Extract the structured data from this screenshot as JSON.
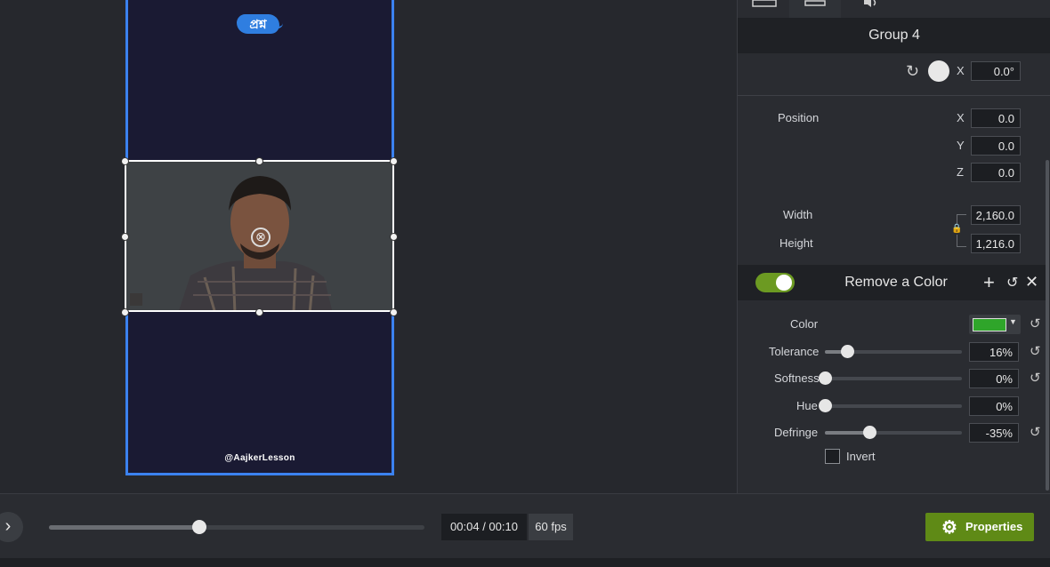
{
  "canvas": {
    "badge_text": "প্রশ্ন",
    "watermark": "@AajkerLesson"
  },
  "panel": {
    "group_title": "Group 4",
    "rotation": {
      "axis_label": "X",
      "value": "0.0°"
    },
    "position": {
      "label": "Position",
      "x_label": "X",
      "x_value": "0.0",
      "y_label": "Y",
      "y_value": "0.0",
      "z_label": "Z",
      "z_value": "0.0"
    },
    "size": {
      "width_label": "Width",
      "width_value": "2,160.0",
      "height_label": "Height",
      "height_value": "1,216.0"
    },
    "remove_color": {
      "title": "Remove a Color",
      "enabled": true,
      "color_label": "Color",
      "color_swatch": "#2fa52a",
      "tolerance_label": "Tolerance",
      "tolerance_value": "16%",
      "tolerance": 0.16,
      "softness_label": "Softness",
      "softness_value": "0%",
      "softness": 0,
      "hue_label": "Hue",
      "hue_value": "0%",
      "hue": 0,
      "defringe_label": "Defringe",
      "defringe_value": "-35%",
      "defringe": -0.35,
      "invert_label": "Invert",
      "invert_checked": false
    }
  },
  "playback": {
    "timecode": "00:04 / 00:10",
    "fps": "60 fps",
    "progress": 0.4,
    "properties_label": "Properties"
  },
  "colors": {
    "accent": "#6c9a22",
    "selection": "#3b82f0"
  }
}
